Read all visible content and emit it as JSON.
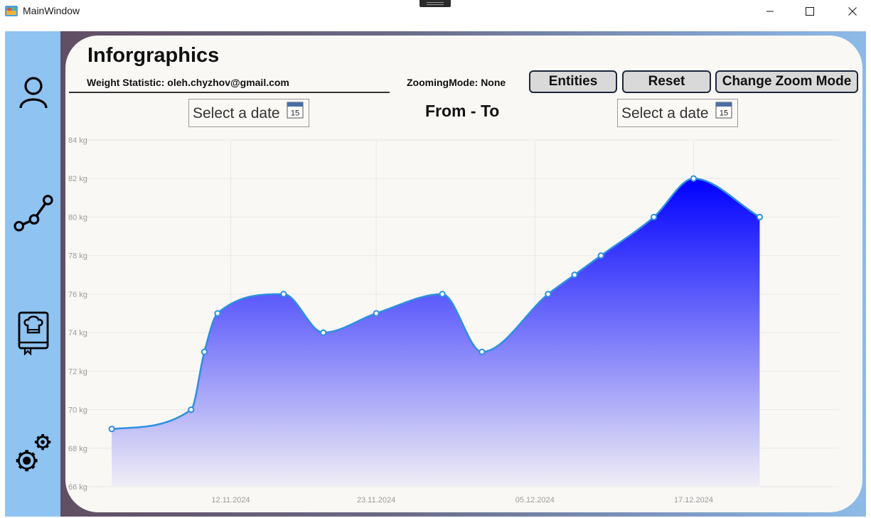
{
  "window": {
    "title": "MainWindow",
    "icon": "app-icon",
    "controls": [
      "minimize-icon",
      "maximize-icon",
      "close-icon"
    ]
  },
  "sidebar": {
    "items": [
      {
        "name": "profile",
        "icon": "user-icon"
      },
      {
        "name": "statistics",
        "icon": "graph-icon"
      },
      {
        "name": "recipes",
        "icon": "chef-book-icon"
      },
      {
        "name": "settings",
        "icon": "gears-icon"
      }
    ]
  },
  "header": {
    "heading": "Inforgraphics",
    "subtitle": "Weight Statistic: oleh.chyzhov@gmail.com",
    "zoom_mode": "ZoomingMode: None"
  },
  "toolbar": {
    "entities_label": "Entities",
    "reset_label": "Reset",
    "change_zoom_label": "Change Zoom Mode"
  },
  "range": {
    "from_placeholder": "Select a date",
    "to_placeholder": "Select a date",
    "calendar_day": "15",
    "from_to_label": "From - To"
  },
  "colors": {
    "line": "#2e8fe0",
    "fill_top": "#0000ff",
    "fill_bottom": "#f0eef5",
    "background": "#f9f8f5",
    "sidebar": "#8ec3f2"
  },
  "chart_data": {
    "type": "area",
    "ylabel_unit": "kg",
    "ylim": [
      66,
      84
    ],
    "xlim": [
      "2024-11-01",
      "2024-12-28"
    ],
    "yticks": [
      66,
      68,
      70,
      72,
      74,
      76,
      78,
      80,
      82,
      84
    ],
    "ytick_labels": [
      "66 kg",
      "68 kg",
      "70 kg",
      "72 kg",
      "74 kg",
      "76 kg",
      "78 kg",
      "80 kg",
      "82 kg",
      "84 kg"
    ],
    "xticks": [
      "2024-11-12",
      "2024-11-23",
      "2024-12-05",
      "2024-12-17"
    ],
    "xtick_labels": [
      "12.11.2024",
      "23.11.2024",
      "05.12.2024",
      "17.12.2024"
    ],
    "grid": true,
    "series": [
      {
        "points": [
          {
            "x": "2024-11-03",
            "y": 69
          },
          {
            "x": "2024-11-09",
            "y": 70
          },
          {
            "x": "2024-11-10",
            "y": 73
          },
          {
            "x": "2024-11-11",
            "y": 75
          },
          {
            "x": "2024-11-16",
            "y": 76
          },
          {
            "x": "2024-11-19",
            "y": 74
          },
          {
            "x": "2024-11-23",
            "y": 75
          },
          {
            "x": "2024-11-28",
            "y": 76
          },
          {
            "x": "2024-12-01",
            "y": 73
          },
          {
            "x": "2024-12-06",
            "y": 76
          },
          {
            "x": "2024-12-08",
            "y": 77
          },
          {
            "x": "2024-12-10",
            "y": 78
          },
          {
            "x": "2024-12-14",
            "y": 80
          },
          {
            "x": "2024-12-17",
            "y": 82
          },
          {
            "x": "2024-12-22",
            "y": 80
          }
        ]
      }
    ]
  }
}
